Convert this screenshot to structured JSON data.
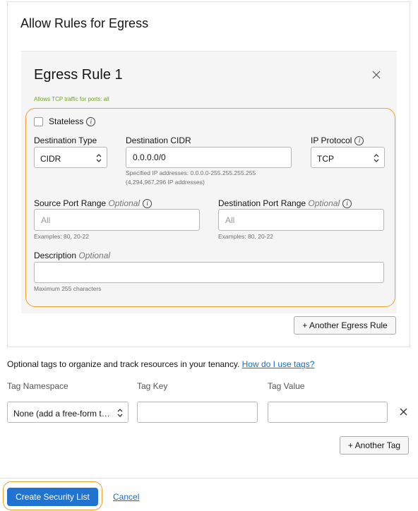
{
  "section": {
    "title": "Allow Rules for Egress"
  },
  "rule": {
    "title": "Egress Rule 1",
    "summary": "Allows TCP traffic for ports: all",
    "stateless_label": "Stateless",
    "stateless_checked": false,
    "destination_type": {
      "label": "Destination Type",
      "value": "CIDR"
    },
    "destination_cidr": {
      "label": "Destination CIDR",
      "value": "0.0.0.0/0",
      "hint_line1": "Specified IP addresses: 0.0.0.0-255.255.255.255",
      "hint_line2": "(4,294,967,296 IP addresses)"
    },
    "ip_protocol": {
      "label": "IP Protocol",
      "value": "TCP"
    },
    "source_port": {
      "label": "Source Port Range",
      "optional": "Optional",
      "placeholder": "All",
      "value": "",
      "hint": "Examples: 80, 20-22"
    },
    "destination_port": {
      "label": "Destination Port Range",
      "optional": "Optional",
      "placeholder": "All",
      "value": "",
      "hint": "Examples: 80, 20-22"
    },
    "description": {
      "label": "Description",
      "optional": "Optional",
      "value": "",
      "hint": "Maximum 255 characters"
    }
  },
  "another_rule_button": "+ Another Egress Rule",
  "tags": {
    "intro": "Optional tags to organize and track resources in your tenancy.",
    "help_link": "How do I use tags?",
    "col_namespace": "Tag Namespace",
    "col_key": "Tag Key",
    "col_value": "Tag Value",
    "namespace_value": "None (add a free-form t…",
    "key_value": "",
    "value_value": "",
    "another_tag_button": "+ Another Tag"
  },
  "footer": {
    "create_button": "Create Security List",
    "cancel_link": "Cancel"
  },
  "colors": {
    "primary": "#2173d0",
    "link": "#1a6bc4",
    "highlight": "#f0a12b",
    "summary_green": "#6ea61c"
  },
  "icons": [
    "close-icon",
    "info-icon",
    "chevron-updown-icon",
    "remove-tag-icon"
  ]
}
